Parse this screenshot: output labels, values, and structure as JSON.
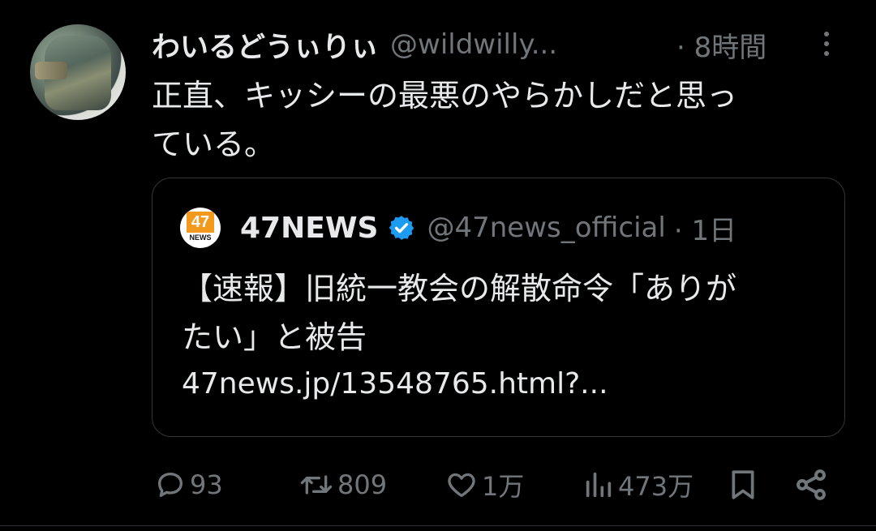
{
  "tweet": {
    "author_name": "わいるどうぃりぃ",
    "author_handle": "@wildwilly...",
    "time": "· 8時間",
    "text": "正直、キッシーの最悪のやらかしだと思っ\nている。"
  },
  "quote": {
    "logo_number": "47",
    "logo_sub": "NEWS",
    "author_name": "47NEWS",
    "author_handle": "@47news_official",
    "time": "· 1日",
    "text": "【速報】旧統一教会の解散命令「ありが\nたい」と被告",
    "link": "47news.jp/13548765.html?..."
  },
  "actions": {
    "replies": "93",
    "reposts": "809",
    "likes": "1万",
    "views": "473万"
  },
  "icons": [
    "more-icon",
    "verified-badge-icon",
    "reply-icon",
    "repost-icon",
    "like-icon",
    "views-icon",
    "bookmark-icon",
    "share-icon"
  ],
  "colors": {
    "background": "#000000",
    "text": "#e7e9ea",
    "secondary": "#71767b",
    "verified": "#1d9bf0",
    "logo_orange": "#f39a1e"
  }
}
